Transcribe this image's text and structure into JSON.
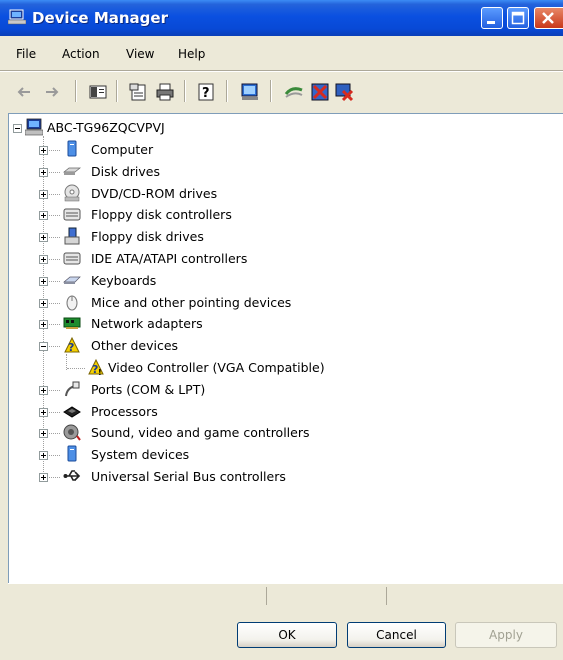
{
  "window": {
    "title": "Device Manager"
  },
  "menu": {
    "items": [
      "File",
      "Action",
      "View",
      "Help"
    ]
  },
  "tree": {
    "root": "ABC-TG96ZQCVPVJ",
    "nodes": [
      {
        "label": "Computer",
        "icon": "computer-icon",
        "expanded": false
      },
      {
        "label": "Disk drives",
        "icon": "disk-drive-icon",
        "expanded": false
      },
      {
        "label": "DVD/CD-ROM drives",
        "icon": "cdrom-icon",
        "expanded": false
      },
      {
        "label": "Floppy disk controllers",
        "icon": "controller-icon",
        "expanded": false
      },
      {
        "label": "Floppy disk drives",
        "icon": "floppy-drive-icon",
        "expanded": false
      },
      {
        "label": "IDE ATA/ATAPI controllers",
        "icon": "controller-icon",
        "expanded": false
      },
      {
        "label": "Keyboards",
        "icon": "keyboard-icon",
        "expanded": false
      },
      {
        "label": "Mice and other pointing devices",
        "icon": "mouse-icon",
        "expanded": false
      },
      {
        "label": "Network adapters",
        "icon": "network-card-icon",
        "expanded": false
      },
      {
        "label": "Other devices",
        "icon": "question-device-icon",
        "expanded": true,
        "children": [
          {
            "label": "Video Controller (VGA Compatible)",
            "icon": "warning-device-icon"
          }
        ]
      },
      {
        "label": "Ports (COM & LPT)",
        "icon": "port-icon",
        "expanded": false
      },
      {
        "label": "Processors",
        "icon": "processor-icon",
        "expanded": false
      },
      {
        "label": "Sound, video and game controllers",
        "icon": "sound-icon",
        "expanded": false
      },
      {
        "label": "System devices",
        "icon": "system-icon",
        "expanded": false
      },
      {
        "label": "Universal Serial Bus controllers",
        "icon": "usb-icon",
        "expanded": false
      }
    ]
  },
  "buttons": {
    "ok": "OK",
    "cancel": "Cancel",
    "apply": "Apply"
  }
}
